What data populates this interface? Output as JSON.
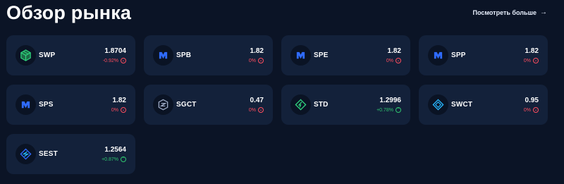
{
  "header": {
    "title": "Обзор рынка",
    "see_more_label": "Посмотреть больше",
    "see_more_icon": "arrow-right-icon"
  },
  "colors": {
    "background": "#0b1426",
    "card": "#13213a",
    "negative": "#ff4d5e",
    "positive": "#2fc56f",
    "green_token": "#2fd37d",
    "blue_token": "#2f6bff",
    "cyan_token": "#27b7ff",
    "slate_token": "#9aa7c2"
  },
  "cards": [
    {
      "ticker": "SWP",
      "price": "1.8704",
      "change": "-0.92%",
      "direction": "down",
      "icon": "swp-cube-icon"
    },
    {
      "ticker": "SPB",
      "price": "1.82",
      "change": "0%",
      "direction": "down",
      "icon": "spb-token-icon"
    },
    {
      "ticker": "SPE",
      "price": "1.82",
      "change": "0%",
      "direction": "down",
      "icon": "spe-token-icon"
    },
    {
      "ticker": "SPP",
      "price": "1.82",
      "change": "0%",
      "direction": "down",
      "icon": "spp-token-icon"
    },
    {
      "ticker": "SPS",
      "price": "1.82",
      "change": "0%",
      "direction": "down",
      "icon": "sps-token-icon"
    },
    {
      "ticker": "SGCT",
      "price": "0.47",
      "change": "0%",
      "direction": "down",
      "icon": "sgct-shield-icon"
    },
    {
      "ticker": "STD",
      "price": "1.2996",
      "change": "+0.78%",
      "direction": "up",
      "icon": "std-diamond-icon"
    },
    {
      "ticker": "SWCT",
      "price": "0.95",
      "change": "0%",
      "direction": "down",
      "icon": "swct-diamond-icon"
    },
    {
      "ticker": "SEST",
      "price": "1.2564",
      "change": "+0.87%",
      "direction": "up",
      "icon": "sest-diamond-icon"
    }
  ]
}
